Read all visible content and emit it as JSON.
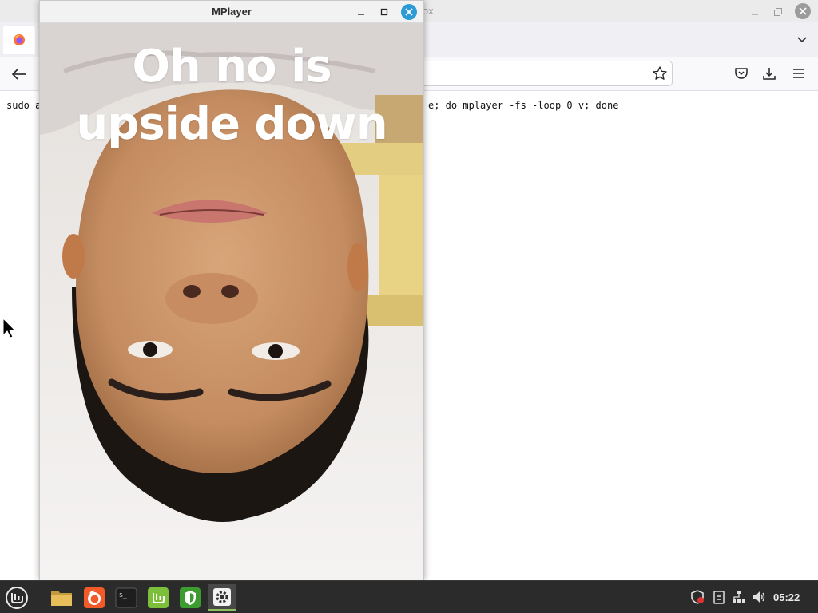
{
  "firefox": {
    "title_fragment": "efox",
    "content_line_left": "sudo a",
    "content_line_right": "e; do mplayer -fs -loop 0 v; done"
  },
  "mplayer": {
    "title": "MPlayer",
    "caption_line1": "Oh no is",
    "caption_line2": "upside down"
  },
  "taskbar": {
    "apps": [
      {
        "name": "menu",
        "icon": "linux-mint-menu-icon"
      },
      {
        "name": "files",
        "icon": "folder-icon"
      },
      {
        "name": "firefox",
        "icon": "firefox-icon"
      },
      {
        "name": "terminal",
        "icon": "terminal-icon"
      },
      {
        "name": "mint-update",
        "icon": "mint-update-icon"
      },
      {
        "name": "shield",
        "icon": "shield-icon"
      },
      {
        "name": "mplayer",
        "icon": "gear-icon"
      }
    ],
    "tray": [
      "shield-tray-icon",
      "clipboard-tray-icon",
      "network-tray-icon",
      "volume-tray-icon"
    ],
    "clock": "05:22"
  },
  "colors": {
    "taskbar_bg": "#2b2b2b",
    "mplayer_close": "#2c9ad5",
    "active_indicator": "#8fbf5f"
  }
}
